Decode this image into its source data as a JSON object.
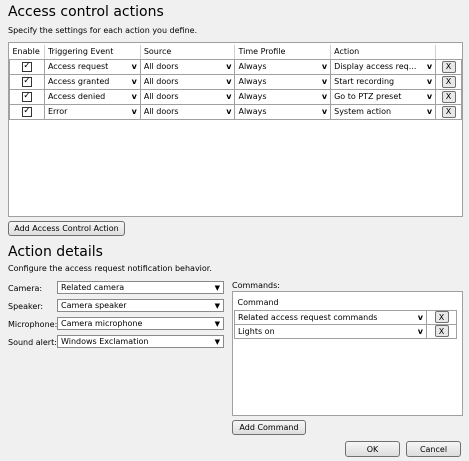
{
  "header": {
    "title": "Access control actions",
    "subtitle": "Specify the settings for each action you define."
  },
  "actions_table": {
    "columns": [
      "Enable",
      "Triggering Event",
      "Source",
      "Time Profile",
      "Action"
    ],
    "rows": [
      {
        "enabled": true,
        "event": "Access request",
        "source": "All doors",
        "time_profile": "Always",
        "action": "Display access req..."
      },
      {
        "enabled": true,
        "event": "Access granted",
        "source": "All doors",
        "time_profile": "Always",
        "action": "Start recording"
      },
      {
        "enabled": true,
        "event": "Access denied",
        "source": "All doors",
        "time_profile": "Always",
        "action": "Go to PTZ preset"
      },
      {
        "enabled": true,
        "event": "Error",
        "source": "All doors",
        "time_profile": "Always",
        "action": "System action"
      }
    ],
    "dropdown_glyph": "v",
    "delete_glyph": "X",
    "check_glyph": "✓"
  },
  "add_action_button": "Add Access Control Action",
  "details": {
    "title": "Action details",
    "subtitle": "Configure the access request notification behavior.",
    "fields": [
      {
        "label": "Camera:",
        "value": "Related camera"
      },
      {
        "label": "Speaker:",
        "value": "Camera speaker"
      },
      {
        "label": "Microphone:",
        "value": "Camera microphone"
      },
      {
        "label": "Sound alert:",
        "value": "Windows Exclamation"
      }
    ],
    "combo_glyph": "▼"
  },
  "commands": {
    "label": "Commands:",
    "column": "Command",
    "rows": [
      "Related access request commands",
      "Lights on"
    ],
    "add_button": "Add Command"
  },
  "footer": {
    "ok": "OK",
    "cancel": "Cancel"
  }
}
